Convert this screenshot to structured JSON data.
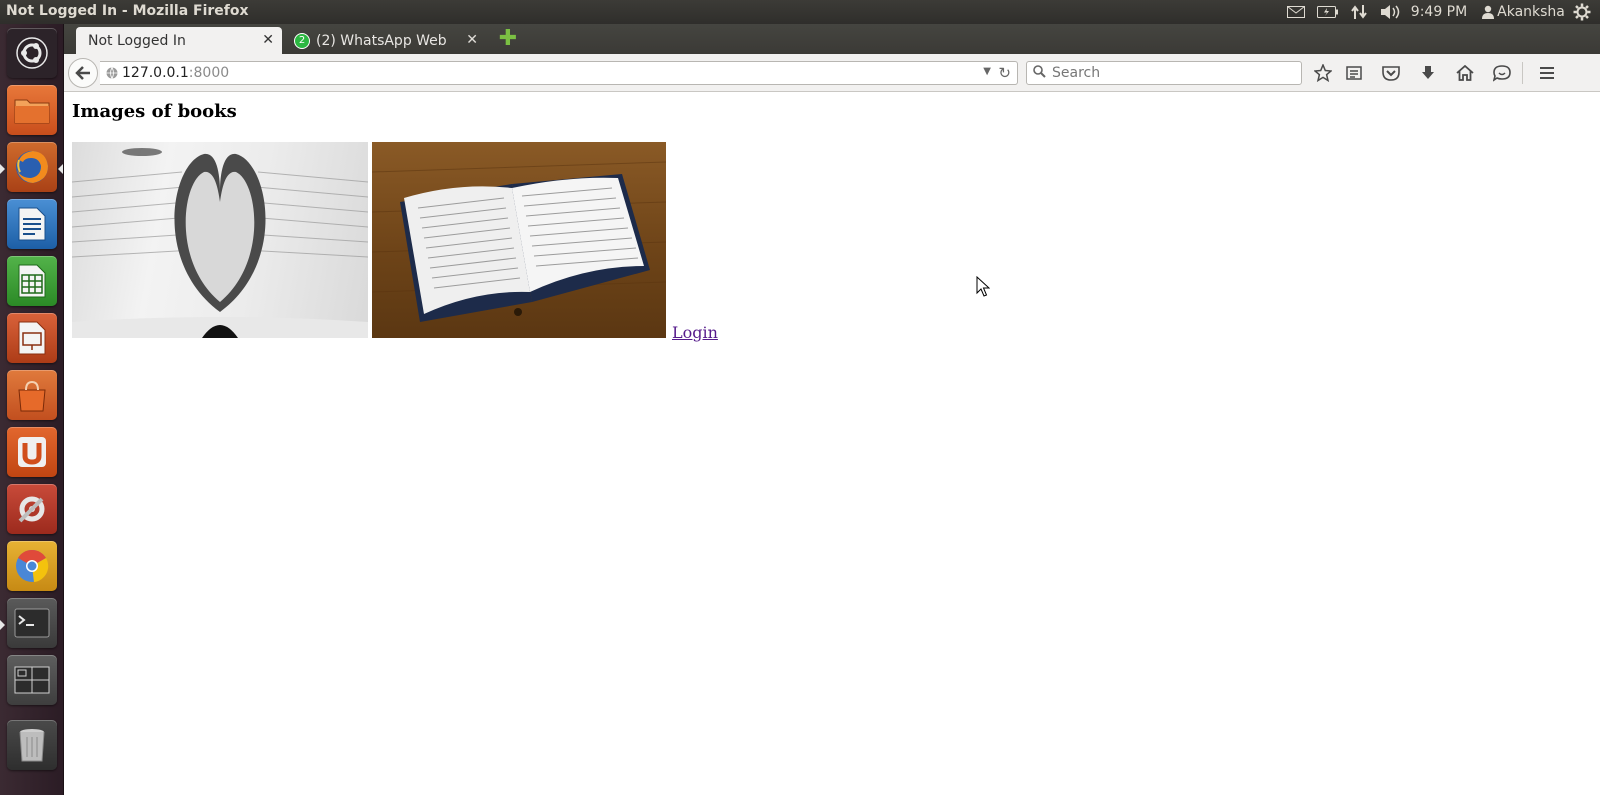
{
  "system_panel": {
    "window_title": "Not Logged In - Mozilla Firefox",
    "clock": "9:49 PM",
    "user": "Akanksha",
    "indicators": [
      "mail-icon",
      "battery-icon",
      "network-icon",
      "volume-icon",
      "user-icon",
      "gear-icon"
    ]
  },
  "launcher": {
    "items": [
      "ubuntu-dash",
      "files",
      "firefox",
      "libreoffice-writer",
      "libreoffice-calc",
      "libreoffice-impress",
      "software-center",
      "ubuntu-one",
      "system-settings",
      "chromium",
      "terminal",
      "workspace-switcher",
      "trash"
    ]
  },
  "browser": {
    "tabs": [
      {
        "label": "Not Logged In",
        "active": true
      },
      {
        "label": "(2) WhatsApp Web",
        "badge": "2",
        "active": false
      }
    ],
    "url_host": "127.0.0.1",
    "url_port": ":8000",
    "search_placeholder": "Search"
  },
  "page": {
    "heading": "Images of books",
    "login_link": "Login"
  },
  "colors": {
    "panel_bg": "#3c3b37",
    "launcher_bg": "#3b2a32",
    "link_visited": "#551a8b",
    "whatsapp_green": "#2bb741"
  }
}
